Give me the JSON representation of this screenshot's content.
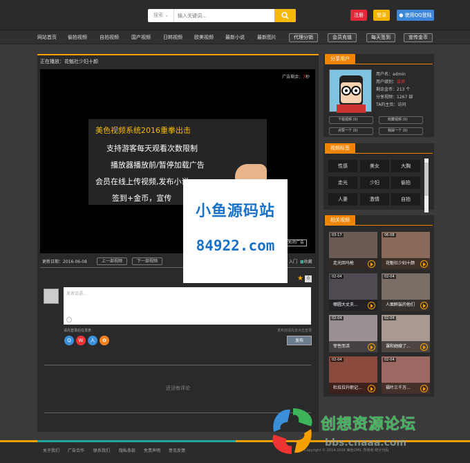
{
  "topbar": {
    "search_type": "搜索",
    "search_placeholder": "输入关键词...",
    "register": "注册",
    "login": "登录",
    "qq_login": "使用QQ登陆",
    "colors": {
      "register": "#e6283a",
      "login": "#f5b400",
      "qq": "#3e86d9",
      "search_button": "#f5b90a"
    }
  },
  "nav": {
    "items": [
      "网站首页",
      "偷拍视频",
      "自拍视频",
      "国产视频",
      "日韩视频",
      "欧美视频",
      "最新小说",
      "最新图片"
    ],
    "buttons": [
      "代理分销",
      "会员充值",
      "每天签到",
      "宣传金币"
    ]
  },
  "player": {
    "now_playing_label": "正在播放：",
    "now_playing_title": "花魁社少妇十颜",
    "ad_remaining_label": "广告剩余：",
    "ad_remaining_value": "7",
    "ad_remaining_unit": "秒",
    "close_ad": "关闭广告",
    "promo": {
      "headline": "美色视频系统2016重拳出击",
      "lines": [
        "支持游客每天观看次数限制",
        "播放器播放前/暂停加载广告",
        "会员在线上传视频,发布小说",
        "签到+金币，宣传"
      ]
    }
  },
  "episode": {
    "update_label": "更新日期：",
    "update_date": "2016-06-08",
    "prev": "上一部视频",
    "next": "下一部视频",
    "right_fragment": "入门",
    "collect": "收藏",
    "star_count": "0"
  },
  "comment": {
    "placeholder": "发表话语...",
    "login_hint": "请先登录后在发表",
    "login_hint_right": "发布前请先去点击登录",
    "publish": "发布",
    "no_comment": "还没有评论"
  },
  "user_panel": {
    "title": "分享用户",
    "info": [
      {
        "label": "用户名：",
        "value": "admin"
      },
      {
        "label": "用户级别：",
        "value": "会员"
      },
      {
        "label": "剩余金币：",
        "value": "213 个"
      },
      {
        "label": "分享视频：",
        "value": "1267 部"
      },
      {
        "label": "TA的主页：",
        "value": "访问"
      }
    ],
    "buttons": [
      "下载视频 (0)",
      "收藏视频 (0)",
      "点赞一个 (0)",
      "我踩一个 (0)"
    ]
  },
  "tags_panel": {
    "title": "视频标签",
    "tags": [
      "性感",
      "美女",
      "大胸",
      "走光",
      "少妇",
      "偷拍",
      "人妻",
      "激情",
      "自拍"
    ]
  },
  "related_panel": {
    "title": "相关视频",
    "videos": [
      {
        "date": "03-17",
        "title": "走光回马枪"
      },
      {
        "date": "06-08",
        "title": "花魁社少妇十颜"
      },
      {
        "date": "02-04",
        "title": "哪圆大丈夫..."
      },
      {
        "date": "02-04",
        "title": "人面醉装的他们"
      },
      {
        "date": "02-04",
        "title": "宰性而活"
      },
      {
        "date": "02-04",
        "title": "课和她嫂了..."
      },
      {
        "date": "02-04",
        "title": "杜拉拉升职记..."
      },
      {
        "date": "02-04",
        "title": "福叶三千万..."
      }
    ]
  },
  "footer": {
    "links": [
      "关于我们",
      "广告合作",
      "联系我们",
      "隐私条款",
      "免责声明",
      "意见反馈"
    ],
    "copyright": "Copyright © 2014-2016  美色CMS.  所有有  统计代码"
  },
  "watermarks": {
    "site_cn": "小鱼源码站",
    "site_num": "84922.com",
    "forum_cn": "创想资源论坛",
    "forum_url": "bbs.cnaaa.com"
  }
}
